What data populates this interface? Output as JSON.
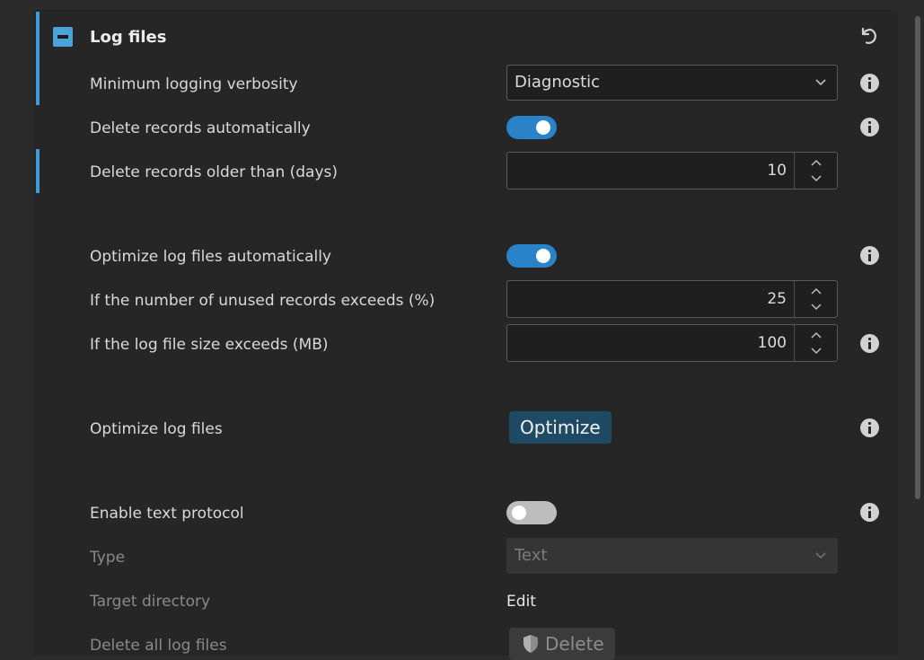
{
  "section": {
    "title": "Log files"
  },
  "rows": {
    "min_verbosity": {
      "label": "Minimum logging verbosity",
      "value": "Diagnostic"
    },
    "delete_auto": {
      "label": "Delete records automatically",
      "enabled": true
    },
    "delete_older": {
      "label": "Delete records older than (days)",
      "value": "10"
    },
    "optimize_auto": {
      "label": "Optimize log files automatically",
      "enabled": true
    },
    "unused_exceeds": {
      "label": "If the number of unused records exceeds (%)",
      "value": "25"
    },
    "size_exceeds": {
      "label": "If the log file size exceeds (MB)",
      "value": "100"
    },
    "optimize_files": {
      "label": "Optimize log files",
      "button": "Optimize"
    },
    "text_protocol": {
      "label": "Enable text protocol",
      "enabled": false
    },
    "type": {
      "label": "Type",
      "value": "Text"
    },
    "target_dir": {
      "label": "Target directory",
      "link": "Edit"
    },
    "delete_all": {
      "label": "Delete all log files",
      "button": "Delete"
    }
  },
  "colors": {
    "accent": "#3d9cd4",
    "toggle_on": "#2a82c8",
    "button": "#1f4a66"
  }
}
